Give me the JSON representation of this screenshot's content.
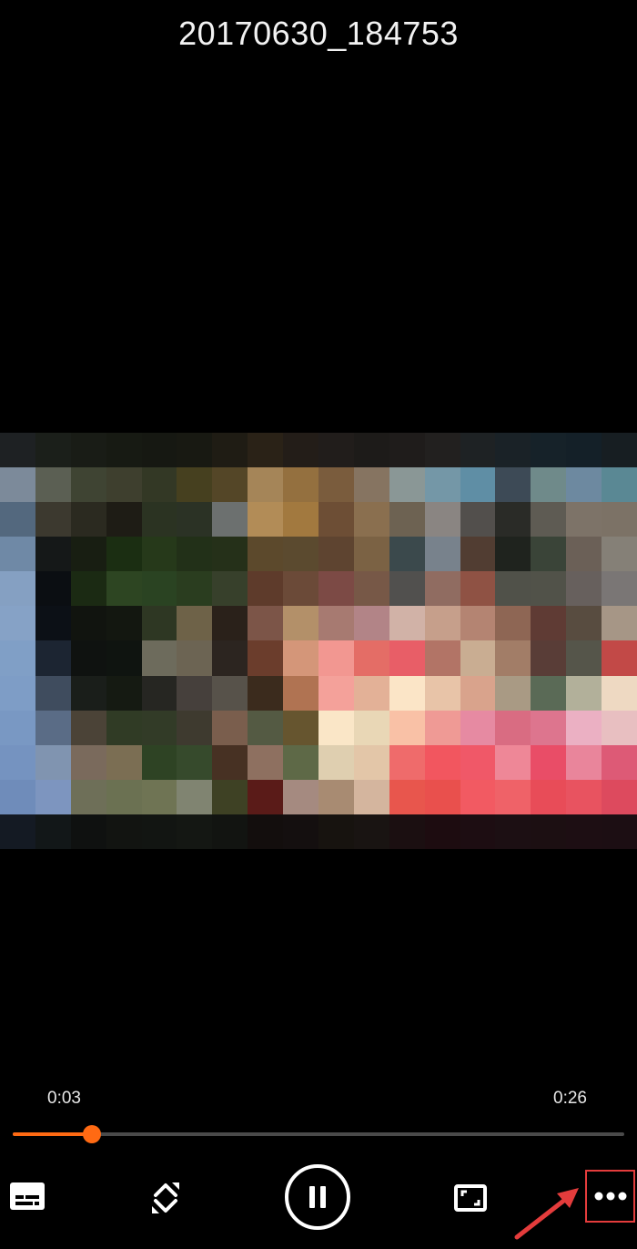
{
  "player": {
    "title": "20170630_184753",
    "current_time": "0:03",
    "duration": "0:26",
    "progress_fraction": 0.13,
    "accent_color": "#ff6a13"
  },
  "controls": [
    {
      "name": "subtitles-button",
      "icon": "subtitles-icon"
    },
    {
      "name": "rotate-button",
      "icon": "rotate-icon"
    },
    {
      "name": "pause-button",
      "icon": "pause-icon"
    },
    {
      "name": "aspect-ratio-button",
      "icon": "aspect-ratio-icon"
    },
    {
      "name": "more-options-button",
      "icon": "more-horizontal-icon"
    }
  ],
  "annotation": {
    "highlight_color": "#e43c3c",
    "points_to": "more-options-button"
  },
  "video_frame": {
    "description_icon": "pixelated-video-frame",
    "palette": [
      [
        "#1e2123",
        "#1b1f1a",
        "#191c16",
        "#171a13",
        "#161812",
        "#181912",
        "#1f1c14",
        "#2a2217",
        "#231d18",
        "#211d1b",
        "#1d1b19",
        "#1f1c1b",
        "#22201f",
        "#1e2224",
        "#1a2227",
        "#162229",
        "#142028",
        "#171e22"
      ],
      [
        "#7c8a9a",
        "#5b5f53",
        "#3f4433",
        "#3e3f2e",
        "#333825",
        "#46401f",
        "#544627",
        "#a58558",
        "#94703f",
        "#7a5c3d",
        "#867461",
        "#8a9796",
        "#7497a7",
        "#5f8ea5",
        "#3d4a56",
        "#6f8a8a",
        "#6d89a0",
        "#5a8894"
      ],
      [
        "#53687e",
        "#3c392f",
        "#2b2a20",
        "#1e1c15",
        "#2b3322",
        "#2b3225",
        "#6c706f",
        "#b28c57",
        "#a2793f",
        "#6d4e35",
        "#8a6f4f",
        "#6d6252",
        "#8a8582",
        "#524f4c",
        "#2a2b27",
        "#5e5b53",
        "#7d7368",
        "#7c7266"
      ],
      [
        "#6f89a6",
        "#151818",
        "#181e12",
        "#1b2e12",
        "#26391a",
        "#223018",
        "#253019",
        "#5c492c",
        "#5b4a2f",
        "#5e4430",
        "#7b6244",
        "#3b494c",
        "#78828c",
        "#513d32",
        "#1f231e",
        "#3a4438",
        "#6b6057",
        "#858077"
      ],
      [
        "#85a0c2",
        "#0b0e12",
        "#1b2a13",
        "#2d4522",
        "#2a4322",
        "#2a3d1f",
        "#37402b",
        "#5e3b2b",
        "#6b4a38",
        "#7c4a45",
        "#775847",
        "#51504e",
        "#906c61",
        "#8f5244",
        "#505149",
        "#515249",
        "#67605d",
        "#7a7675"
      ],
      [
        "#86a2c6",
        "#0c1016",
        "#11140f",
        "#131710",
        "#2e3723",
        "#6e6248",
        "#2a211a",
        "#7c5548",
        "#b39069",
        "#a77a71",
        "#b28487",
        "#d1b2a7",
        "#c69f8b",
        "#b48472",
        "#8e6654",
        "#5f3b34",
        "#584c40",
        "#a69686"
      ],
      [
        "#809fc6",
        "#1c2532",
        "#0f1210",
        "#0f1410",
        "#6d6b5c",
        "#6c6453",
        "#2c2520",
        "#6b3d2c",
        "#d49679",
        "#f29791",
        "#e46d66",
        "#e85e67",
        "#b27466",
        "#c9ad92",
        "#a27d67",
        "#593d37",
        "#55554a",
        "#c24947"
      ],
      [
        "#7e9dc6",
        "#3f4c5e",
        "#1a1e1a",
        "#151a12",
        "#262622",
        "#46403c",
        "#57524a",
        "#3b2b1d",
        "#b07352",
        "#f4a19a",
        "#e3b197",
        "#fbe5c7",
        "#e8c4a8",
        "#d9a38c",
        "#a99a84",
        "#5a6a56",
        "#b2b09a",
        "#eed9c2"
      ],
      [
        "#7998c3",
        "#5a6c86",
        "#4b4337",
        "#303b25",
        "#323b27",
        "#3e3a2f",
        "#7a5e4d",
        "#545a43",
        "#66552f",
        "#fae6c7",
        "#e9d7b6",
        "#f9c1a6",
        "#ef9a95",
        "#e68aa2",
        "#d96c82",
        "#dd758e",
        "#ebb0c3",
        "#e8bfc1"
      ],
      [
        "#7593c0",
        "#8094b0",
        "#7a6a5c",
        "#7b6e53",
        "#2e4324",
        "#364a2c",
        "#473123",
        "#8e7060",
        "#5e6947",
        "#dfcfb0",
        "#e3c6a8",
        "#ef6b6b",
        "#f2565f",
        "#f05868",
        "#ee8797",
        "#e94d67",
        "#e9859b",
        "#dd5a76"
      ],
      [
        "#6f8cba",
        "#7d95bf",
        "#6e6f58",
        "#6b7152",
        "#6f7454",
        "#808471",
        "#3e4124",
        "#5a1b18",
        "#a58a80",
        "#a88b72",
        "#d4b59e",
        "#e8564d",
        "#e9504d",
        "#f25a62",
        "#ef6268",
        "#e84c58",
        "#e85360",
        "#dd4a5e"
      ],
      [
        "#141a23",
        "#121718",
        "#0f1110",
        "#121411",
        "#121512",
        "#141713",
        "#121411",
        "#130e0d",
        "#140f0f",
        "#17130f",
        "#191412",
        "#1b0f11",
        "#1d0c10",
        "#1d0d12",
        "#1c0f13",
        "#1c0f12",
        "#1d0e13",
        "#1c0e13"
      ]
    ]
  }
}
